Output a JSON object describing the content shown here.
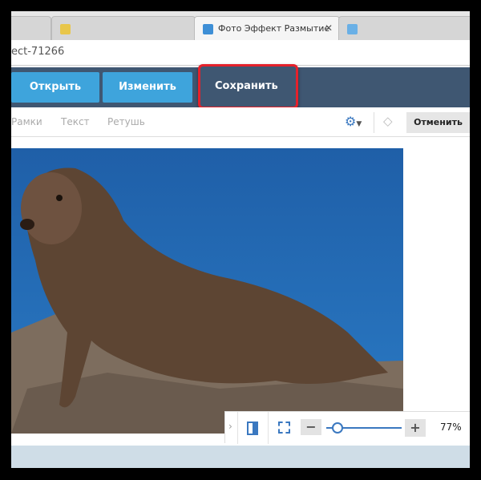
{
  "tabs": [
    {
      "label": "",
      "active": false
    },
    {
      "label": "",
      "active": false
    },
    {
      "label": "Фото Эффект Размытие",
      "active": true
    },
    {
      "label": "",
      "active": false
    }
  ],
  "address": "ect-71266",
  "main_bar": {
    "open": "Открыть",
    "edit": "Изменить",
    "save": "Сохранить"
  },
  "sub_bar": {
    "frames": "Рамки",
    "text": "Текст",
    "retouch": "Ретушь",
    "cancel": "Отменить"
  },
  "zoom": {
    "value": "77%",
    "level": 0.05
  },
  "colors": {
    "toolbar": "#3f5772",
    "button": "#3ea4dc",
    "highlight": "#e5212b"
  }
}
